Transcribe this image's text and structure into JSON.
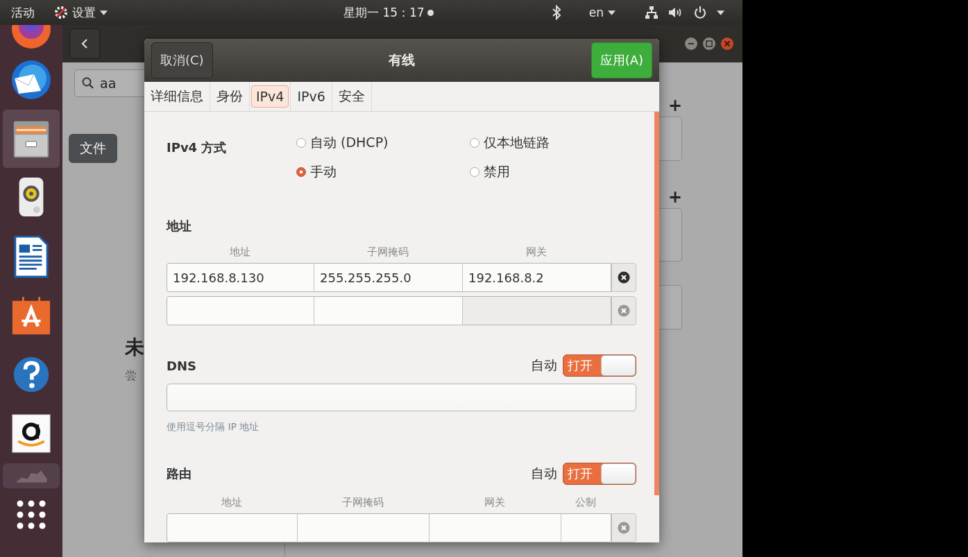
{
  "top_bar": {
    "activities": "活动",
    "app_menu": "设置",
    "clock": "星期一 15：17",
    "language": "en"
  },
  "dock": {
    "items": [
      {
        "kind": "browser",
        "selected": false
      },
      {
        "kind": "mail",
        "selected": false
      },
      {
        "kind": "files",
        "selected": true
      },
      {
        "kind": "music",
        "selected": false
      },
      {
        "kind": "writer",
        "selected": false
      },
      {
        "kind": "software",
        "selected": false
      },
      {
        "kind": "help",
        "selected": false
      },
      {
        "kind": "shop",
        "selected": false
      },
      {
        "kind": "faded",
        "selected": false
      },
      {
        "kind": "apps",
        "selected": false
      }
    ]
  },
  "tooltip": "文件",
  "background_window": {
    "search": {
      "value": "aa"
    },
    "heading": "未",
    "subtext": "尝",
    "add_buttons": [
      "+",
      "+"
    ]
  },
  "dialog": {
    "title": "有线",
    "cancel": "取消(C)",
    "apply": "应用(A)",
    "tabs": [
      {
        "label": "详细信息",
        "selected": false
      },
      {
        "label": "身份",
        "selected": false
      },
      {
        "label": "IPv4",
        "selected": true
      },
      {
        "label": "IPv6",
        "selected": false
      },
      {
        "label": "安全",
        "selected": false
      }
    ],
    "method": {
      "label": "IPv4 方式",
      "options": [
        {
          "label": "自动 (DHCP)",
          "selected": false
        },
        {
          "label": "仅本地链路",
          "selected": false
        },
        {
          "label": "手动",
          "selected": true
        },
        {
          "label": "禁用",
          "selected": false
        }
      ]
    },
    "addresses": {
      "title": "地址",
      "columns": [
        "地址",
        "子网掩码",
        "网关"
      ],
      "rows": [
        {
          "cells": [
            "192.168.8.130",
            "255.255.255.0",
            "192.168.8.2"
          ],
          "disabled": false
        },
        {
          "disabled": true
        }
      ]
    },
    "dns": {
      "title": "DNS",
      "auto_label": "自动",
      "auto_on": true,
      "switch_label": "打开",
      "hint": "使用逗号分隔 IP 地址"
    },
    "routes": {
      "title": "路由",
      "auto_label": "自动",
      "auto_on": true,
      "switch_label": "打开",
      "columns": [
        "地址",
        "子网掩码",
        "网关",
        "公制"
      ],
      "rows": [
        {
          "disabled": true
        }
      ]
    }
  }
}
